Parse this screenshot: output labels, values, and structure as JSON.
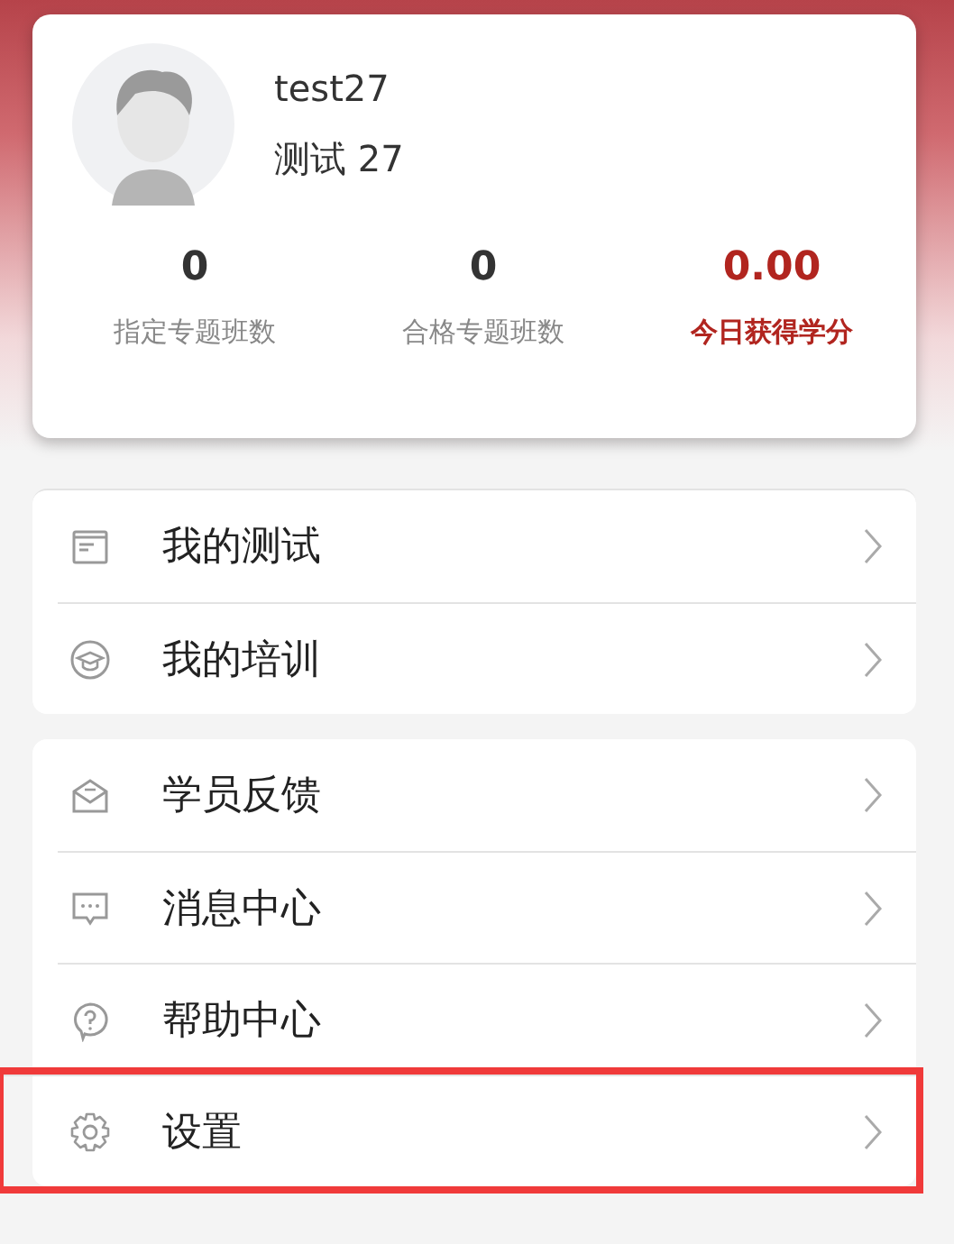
{
  "profile": {
    "username": "test27",
    "display_name": "测试 27"
  },
  "stats": [
    {
      "value": "0",
      "label": "指定专题班数",
      "emphasized": false
    },
    {
      "value": "0",
      "label": "合格专题班数",
      "emphasized": false
    },
    {
      "value": "0.00",
      "label": "今日获得学分",
      "emphasized": true
    }
  ],
  "menu_groups": [
    {
      "items": [
        {
          "kind": "document",
          "label": "我的测试",
          "highlighted": false
        },
        {
          "kind": "cap",
          "label": "我的培训",
          "highlighted": false
        }
      ]
    },
    {
      "items": [
        {
          "kind": "envelope",
          "label": "学员反馈",
          "highlighted": false
        },
        {
          "kind": "chat",
          "label": "消息中心",
          "highlighted": false
        },
        {
          "kind": "question",
          "label": "帮助中心",
          "highlighted": false
        },
        {
          "kind": "gear",
          "label": "设置",
          "highlighted": true
        }
      ]
    }
  ]
}
